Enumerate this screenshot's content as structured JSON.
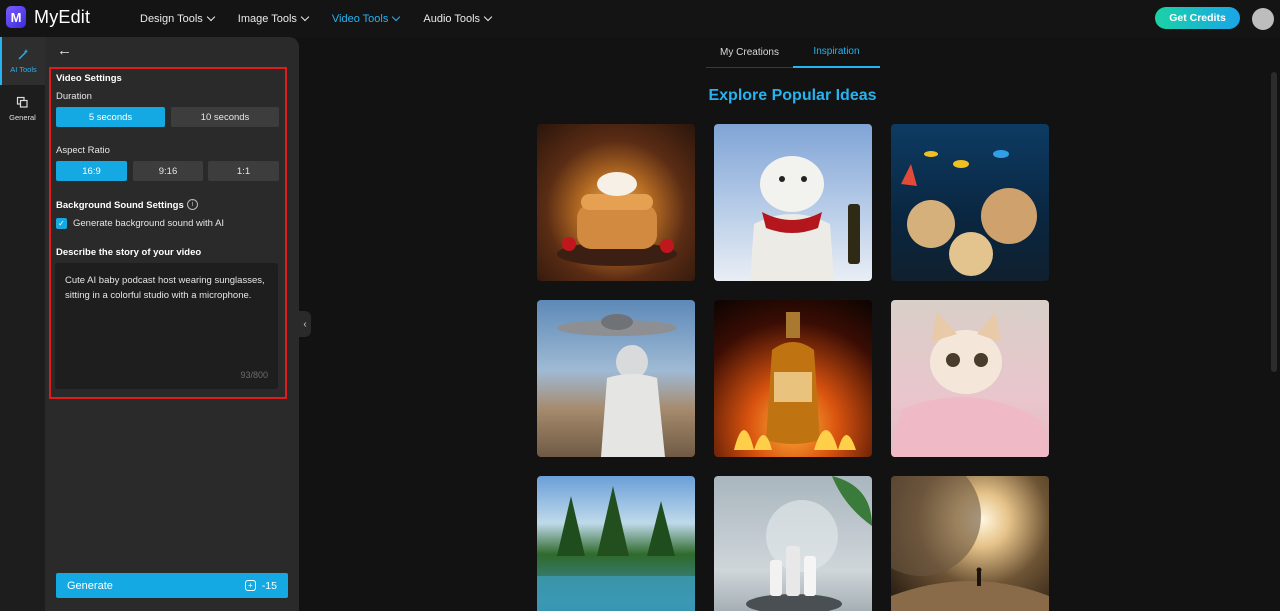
{
  "app": {
    "name": "MyEdit",
    "logo_letter": "M"
  },
  "nav": [
    {
      "label": "Design Tools",
      "active": false
    },
    {
      "label": "Image Tools",
      "active": false
    },
    {
      "label": "Video Tools",
      "active": true
    },
    {
      "label": "Audio Tools",
      "active": false
    }
  ],
  "header": {
    "credits_label": "Get Credits"
  },
  "rail": [
    {
      "label": "AI Tools",
      "icon": "magic-wand-icon"
    },
    {
      "label": "General",
      "icon": "layers-icon"
    }
  ],
  "settings": {
    "section_title": "Video Settings",
    "duration_label": "Duration",
    "duration_options": [
      "5 seconds",
      "10 seconds"
    ],
    "duration_selected": "5 seconds",
    "aspect_label": "Aspect Ratio",
    "aspect_options": [
      "16:9",
      "9:16",
      "1:1"
    ],
    "aspect_selected": "16:9",
    "bg_sound_title": "Background Sound Settings",
    "bg_sound_checkbox_label": "Generate background sound with AI",
    "bg_sound_checked": true,
    "story_label": "Describe the story of your video",
    "story_text": "Cute AI baby podcast host wearing sunglasses, sitting in a colorful studio with a microphone.",
    "char_counter": "93/800",
    "generate_label": "Generate",
    "generate_cost": "-15"
  },
  "main": {
    "tabs": [
      {
        "label": "My Creations",
        "active": false
      },
      {
        "label": "Inspiration",
        "active": true
      }
    ],
    "title": "Explore Popular Ideas"
  },
  "colors": {
    "accent": "#14a9e3",
    "highlight_border": "#e01b1b"
  }
}
